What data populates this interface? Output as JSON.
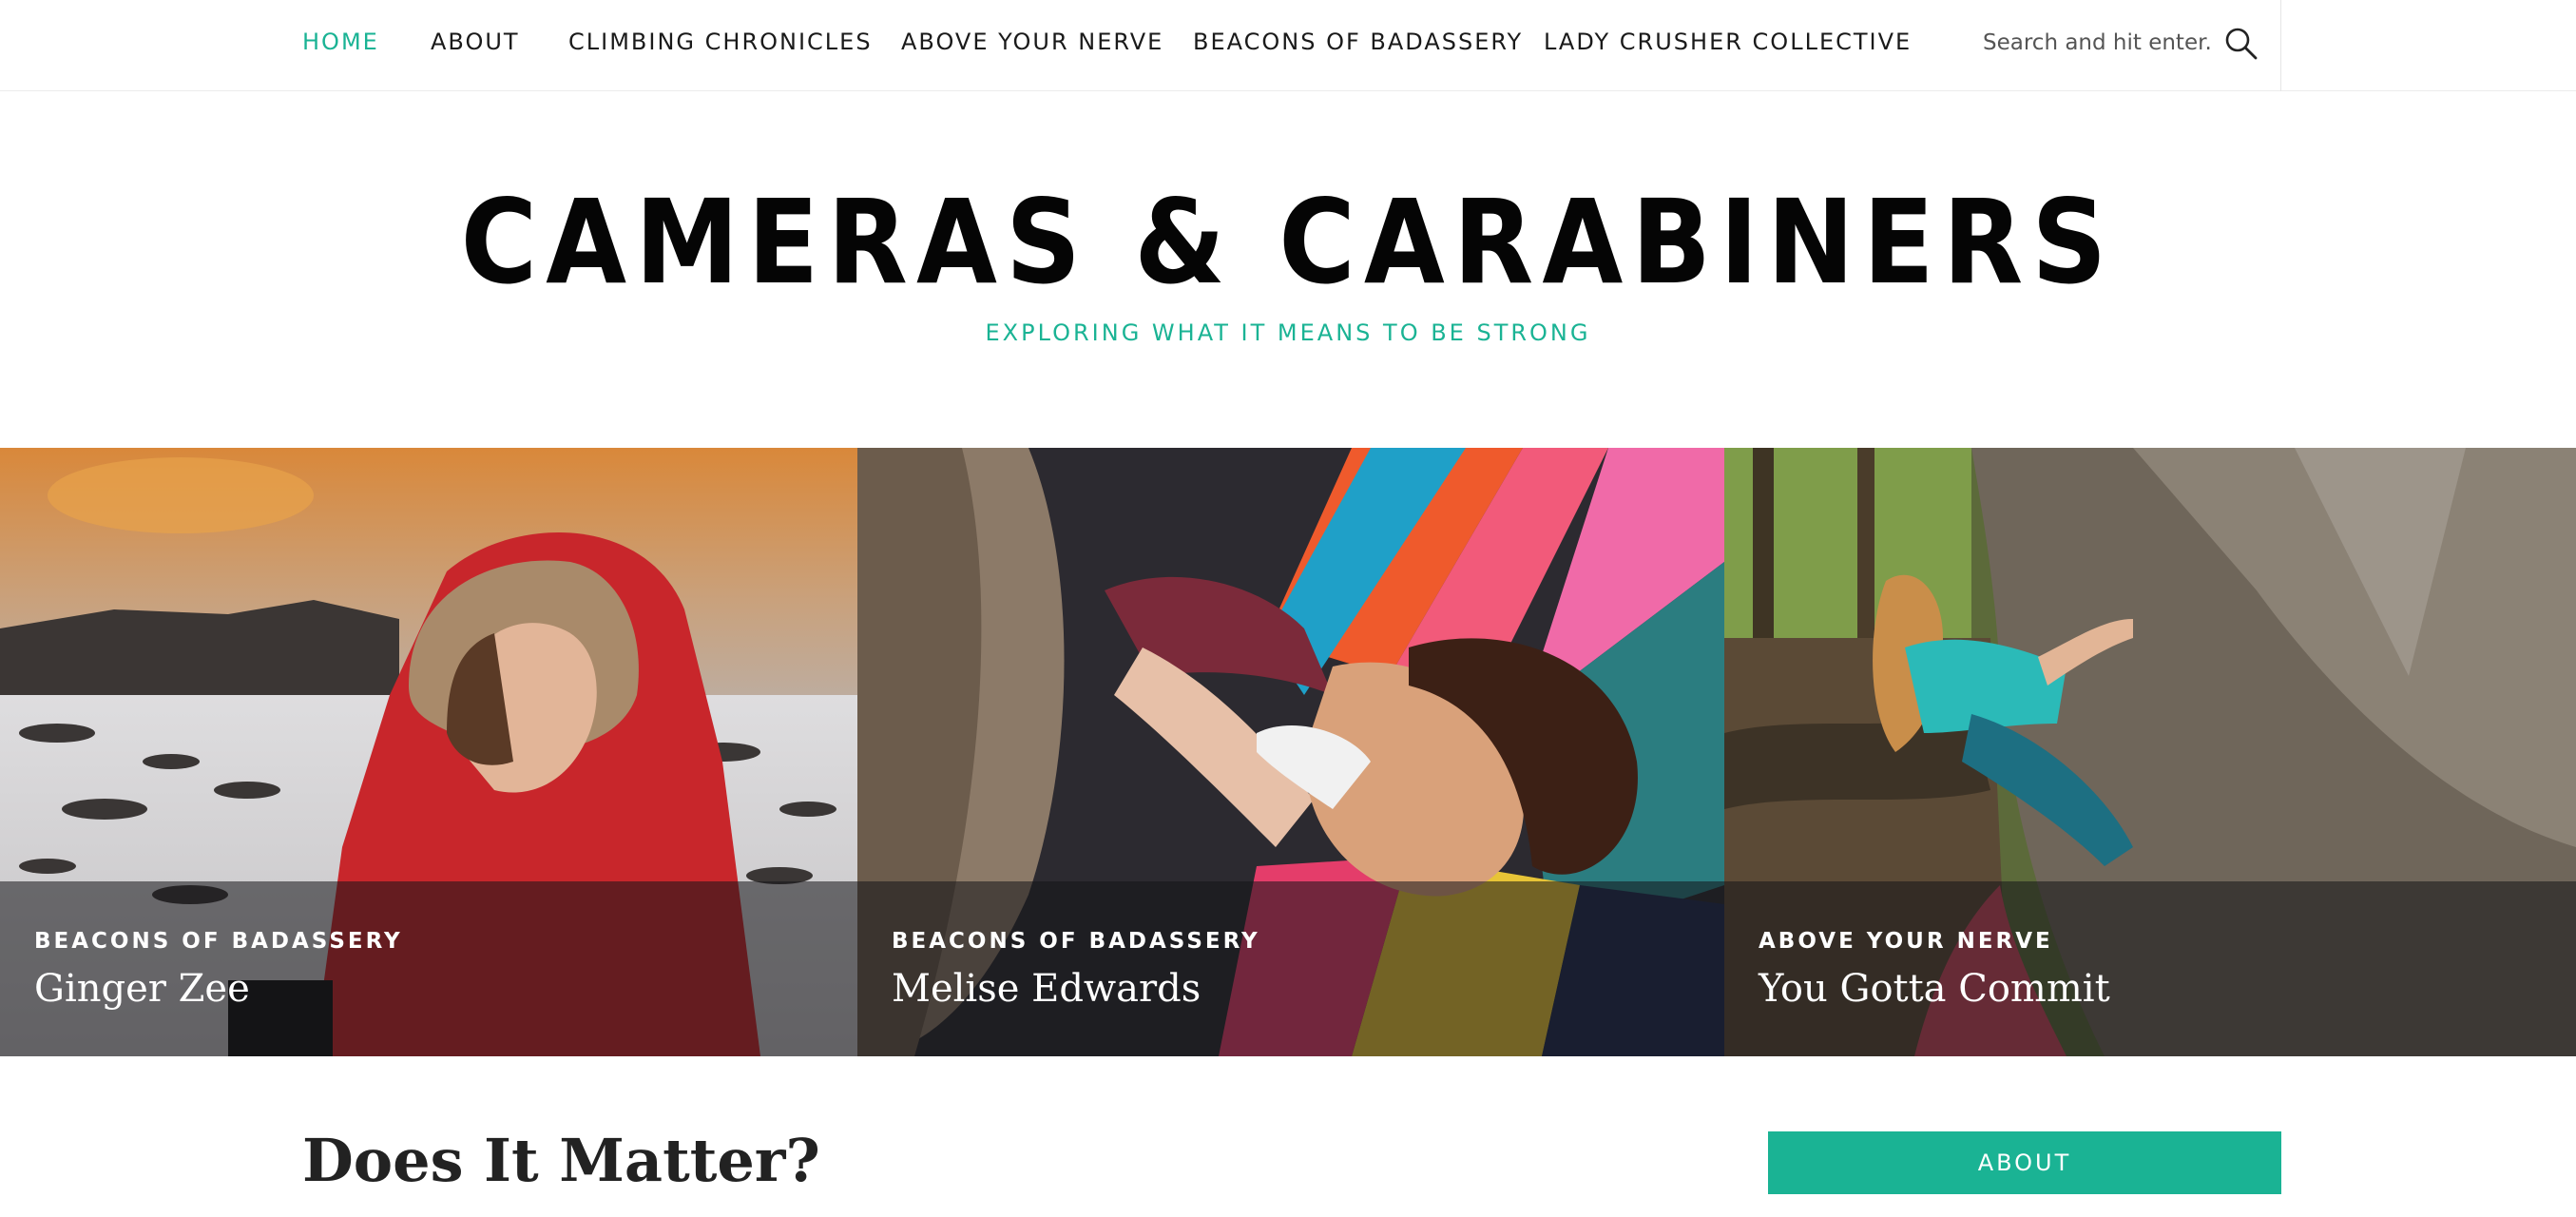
{
  "nav": {
    "items": [
      {
        "label": "HOME",
        "active": true
      },
      {
        "label": "ABOUT",
        "active": false
      },
      {
        "label": "CLIMBING CHRONICLES",
        "active": false
      },
      {
        "label": "ABOVE YOUR NERVE",
        "active": false
      },
      {
        "label": "BEACONS OF BADASSERY",
        "active": false
      },
      {
        "label": "LADY CRUSHER COLLECTIVE",
        "active": false
      }
    ],
    "search_placeholder": "Search and hit enter..."
  },
  "header": {
    "title": "CAMERAS & CARABINERS",
    "tagline": "EXPLORING WHAT IT MEANS TO BE STRONG"
  },
  "slider": {
    "slides": [
      {
        "category": "BEACONS OF BADASSERY",
        "title": "Ginger Zee"
      },
      {
        "category": "BEACONS OF BADASSERY",
        "title": "Melise Edwards"
      },
      {
        "category": "ABOVE YOUR NERVE",
        "title": "You Gotta Commit"
      }
    ]
  },
  "main": {
    "post_title": "Does It Matter?"
  },
  "sidebar": {
    "about_label": "ABOUT"
  },
  "colors": {
    "accent": "#1ab394",
    "text": "#111111",
    "overlay": "rgba(20,20,24,0.55)"
  },
  "icons": {
    "search": "search-icon"
  }
}
